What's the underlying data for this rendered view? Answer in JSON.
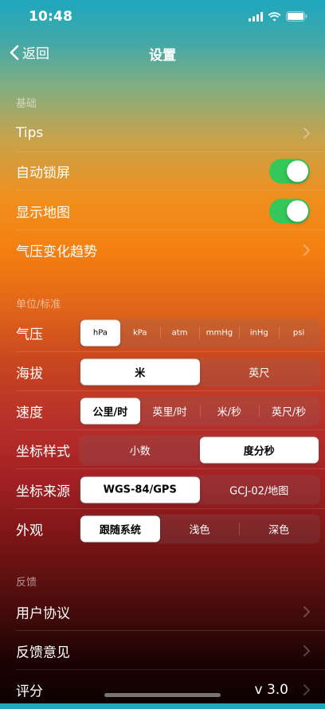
{
  "status_bar": {
    "time": "10:48"
  },
  "nav": {
    "back_label": "返回",
    "title": "设置"
  },
  "sections": {
    "basic": "基础",
    "units": "单位/标准",
    "feedback": "反馈"
  },
  "basic_rows": {
    "tips": "Tips",
    "auto_lock": "自动锁屏",
    "show_map": "显示地图",
    "pressure_trend": "气压变化趋势"
  },
  "toggles": {
    "auto_lock_on": true,
    "show_map_on": true
  },
  "units": {
    "pressure": {
      "label": "气压",
      "options": [
        "hPa",
        "kPa",
        "atm",
        "mmHg",
        "inHg",
        "psi"
      ],
      "selected": "hPa"
    },
    "altitude": {
      "label": "海拔",
      "options": [
        "米",
        "英尺"
      ],
      "selected": "米"
    },
    "speed": {
      "label": "速度",
      "options": [
        "公里/时",
        "英里/时",
        "米/秒",
        "英尺/秒"
      ],
      "selected": "公里/时"
    },
    "coord_style": {
      "label": "坐标样式",
      "options": [
        "小数",
        "度分秒"
      ],
      "selected": "度分秒"
    },
    "coord_source": {
      "label": "坐标来源",
      "options": [
        "WGS-84/GPS",
        "GCJ-02/地图"
      ],
      "selected": "WGS-84/GPS"
    },
    "appearance": {
      "label": "外观",
      "options": [
        "跟随系统",
        "浅色",
        "深色"
      ],
      "selected": "跟随系统"
    }
  },
  "feedback_rows": {
    "user_agreement": "用户协议",
    "feedback": "反馈意见",
    "rate": "评分",
    "version": "v 3.0"
  },
  "colors": {
    "toggle_on": "#34c759",
    "top": "#1ea7be",
    "middle": "#f47f10",
    "bottom": "#0e0101"
  }
}
